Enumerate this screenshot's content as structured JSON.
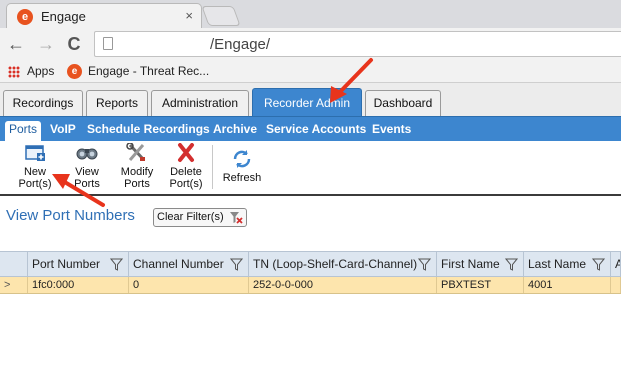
{
  "browser": {
    "tab_title": "Engage",
    "tab_favicon_letter": "e",
    "close_glyph": "×",
    "back_glyph": "←",
    "forward_glyph": "→",
    "reload_glyph": "C",
    "url": "/Engage/",
    "bookmarks": {
      "apps_label": "Apps",
      "bookmark_label": "Engage - Threat Rec..."
    }
  },
  "app_tabs": [
    {
      "label": "Recordings",
      "active": false
    },
    {
      "label": "Reports",
      "active": false
    },
    {
      "label": "Administration",
      "active": false
    },
    {
      "label": "Recorder Admin",
      "active": true
    },
    {
      "label": "Dashboard",
      "active": false
    }
  ],
  "sub_tabs": [
    {
      "label": "Ports",
      "active": true
    },
    {
      "label": "VoIP",
      "active": false
    },
    {
      "label": "Schedule Recordings",
      "active": false
    },
    {
      "label": "Archive",
      "active": false
    },
    {
      "label": "Service Accounts",
      "active": false
    },
    {
      "label": "Events",
      "active": false
    }
  ],
  "toolbar": {
    "new_ports": {
      "line1": "New",
      "line2": "Port(s)"
    },
    "view_ports": {
      "line1": "View",
      "line2": "Ports"
    },
    "modify_ports": {
      "line1": "Modify",
      "line2": "Ports"
    },
    "delete_ports": {
      "line1": "Delete",
      "line2": "Port(s)"
    },
    "refresh": {
      "line1": "Refresh"
    }
  },
  "page": {
    "title": "View Port Numbers",
    "clear_filter_label": "Clear Filter(s)"
  },
  "grid": {
    "columns": [
      "Port Number",
      "Channel Number",
      "TN (Loop-Shelf-Card-Channel)",
      "First Name",
      "Last Name",
      "A"
    ],
    "rows": [
      {
        "indicator": ">",
        "cells": [
          "1fc0:000",
          "0",
          "252-0-0-000",
          "PBXTEST",
          "4001",
          ""
        ]
      }
    ]
  },
  "colors": {
    "accent_blue": "#3d86cf",
    "selected_row": "#fde5ad",
    "annotation_red": "#e8341c",
    "brand_orange": "#e8531f"
  }
}
